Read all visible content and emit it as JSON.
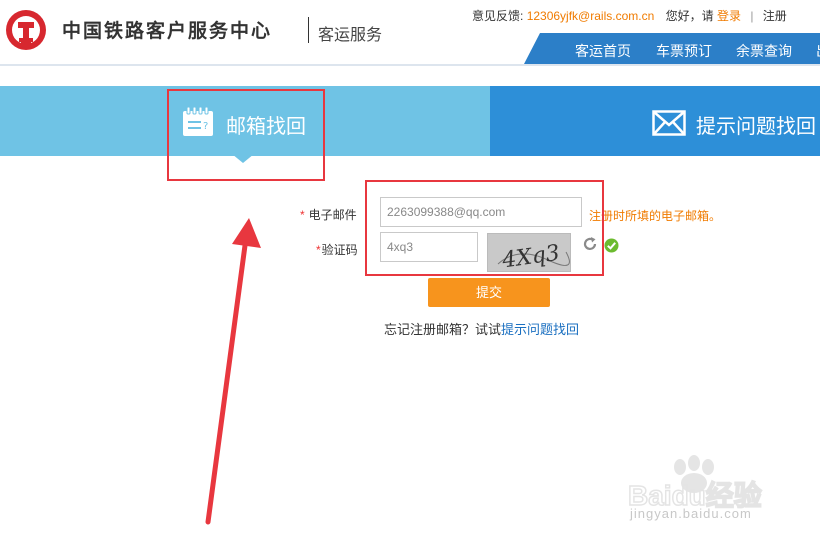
{
  "header": {
    "site_title": "中国铁路客户服务中心",
    "site_sub": "客运服务",
    "feedback_label": "意见反馈:",
    "feedback_email": "12306yjfk@rails.com.cn",
    "greeting": "您好，请",
    "login": "登录",
    "separator": "|",
    "register": "注册",
    "nav": [
      "客运首页",
      "车票预订",
      "余票查询",
      "出"
    ]
  },
  "tabs": {
    "email_recovery": "邮箱找回",
    "question_recovery": "提示问题找回"
  },
  "form": {
    "required_mark": "*",
    "email_label": "电子邮件",
    "email_value": "2263099388@qq.com",
    "email_hint": "注册时所填的电子邮箱。",
    "captcha_label": "验证码",
    "captcha_value": "4xq3",
    "captcha_image_text": "4Xq3",
    "submit_label": "提交",
    "forgot_text": "忘记注册邮箱？试试",
    "forgot_link": "提示问题找回"
  },
  "watermark": {
    "brand": "Baidu经验",
    "url": "jingyan.baidu.com"
  },
  "colors": {
    "tab_email_bg": "#6fc3e5",
    "tab_question_bg": "#2d8fd8",
    "nav_bg": "#2c7fc8",
    "accent_orange": "#f7941d",
    "annotation_red": "#e8373f"
  },
  "icons": [
    "railway-logo-icon",
    "notepad-icon",
    "envelope-icon",
    "refresh-icon",
    "check-icon"
  ]
}
